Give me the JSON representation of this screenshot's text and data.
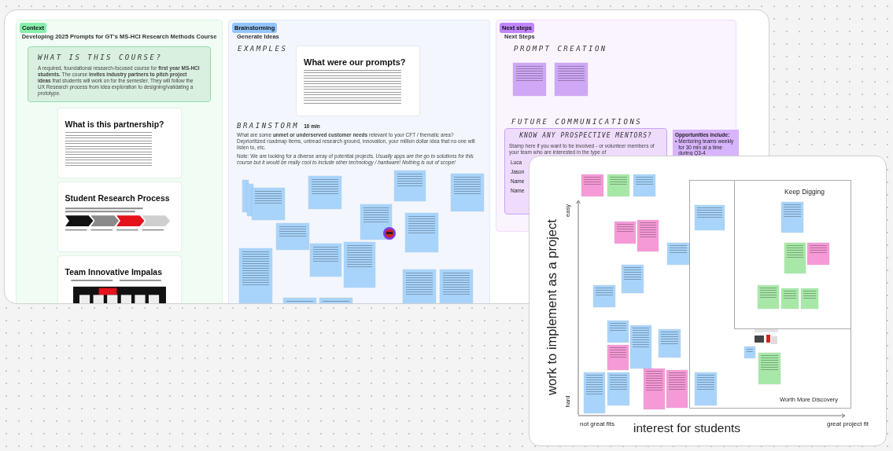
{
  "board": {
    "context": {
      "tag": "Context",
      "title": "Developing 2025 Prompts for GT's MS-HCI Research Methods Course",
      "callout": {
        "heading": "WHAT IS THIS COURSE?",
        "text": "A required, foundational research-focused course for **first year MS-HCI students.** The course **invites industry partners to pitch project ideas** that students will work on for the semester. They will follow the UX Research process from idea exploration to designing/validating a prototype."
      },
      "slides": [
        {
          "kind": "text",
          "title": "What is this partnership?"
        },
        {
          "kind": "process",
          "title": "Student Research Process"
        },
        {
          "kind": "screens",
          "title": "Team Innovative Impalas"
        }
      ]
    },
    "brainstorming": {
      "tag": "Brainstorming",
      "title": "Generate Ideas",
      "examples_heading": "EXAMPLES",
      "example_slide_title": "What were our prompts?",
      "brainstorm_heading": "BRAINSTORM",
      "duration": "10 min",
      "prompt": "What are some **unmet or underserved customer needs** relevant to your CFT / thematic area? Deprioritized roadmap items, untread research ground, innovation, your million dollar idea that no one will listen to, etc.",
      "note": "Note: We are looking for a diverse array of potential projects. *Usually apps are the go to solutions for this course but it would be really cool to include other technology / hardware! Nothing is out of scope!*"
    },
    "next_steps": {
      "tag": "Next steps",
      "title": "Next Steps",
      "prompt_heading": "PROMPT CREATION",
      "comms_heading": "FUTURE COMMUNICATIONS",
      "mentors": {
        "heading": "KNOW ANY PROSPECTIVE MENTORS?",
        "text": "Stamp here if you want to be involved - or volunteer members of your team who are interested in the type of",
        "names": [
          "Luca",
          "Jason",
          "Name",
          "Name"
        ]
      },
      "opportunities": {
        "heading": "Opportunities include:",
        "items": [
          {
            "bullet": "•",
            "text": "Mentoring teams weekly for 30 min at a time during Q3-4"
          }
        ]
      }
    }
  },
  "matrix": {
    "y_label": "work to implement as a project",
    "y_high": "easy",
    "y_low": "hard",
    "x_label": "interest for students",
    "x_low": "not great fits",
    "x_high": "great project fit",
    "quadrants": [
      "Keep Digging",
      "Worth More Discovery"
    ]
  }
}
